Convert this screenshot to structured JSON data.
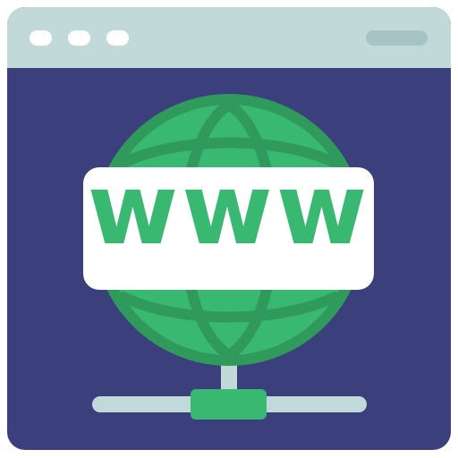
{
  "icon": {
    "name": "www-network-browser-icon",
    "banner_text": "www"
  },
  "colors": {
    "titlebar": "#c2d9d9",
    "titlebar_pill": "#a6c4c4",
    "window_dot": "#ffffff",
    "content_bg": "#3b3f7c",
    "globe_outer": "#2f9a5c",
    "globe_fill": "#39b872",
    "banner_bg": "#ffffff",
    "banner_text": "#39b872",
    "connector_line": "#c2d9d9",
    "connector_node": "#39b872"
  }
}
